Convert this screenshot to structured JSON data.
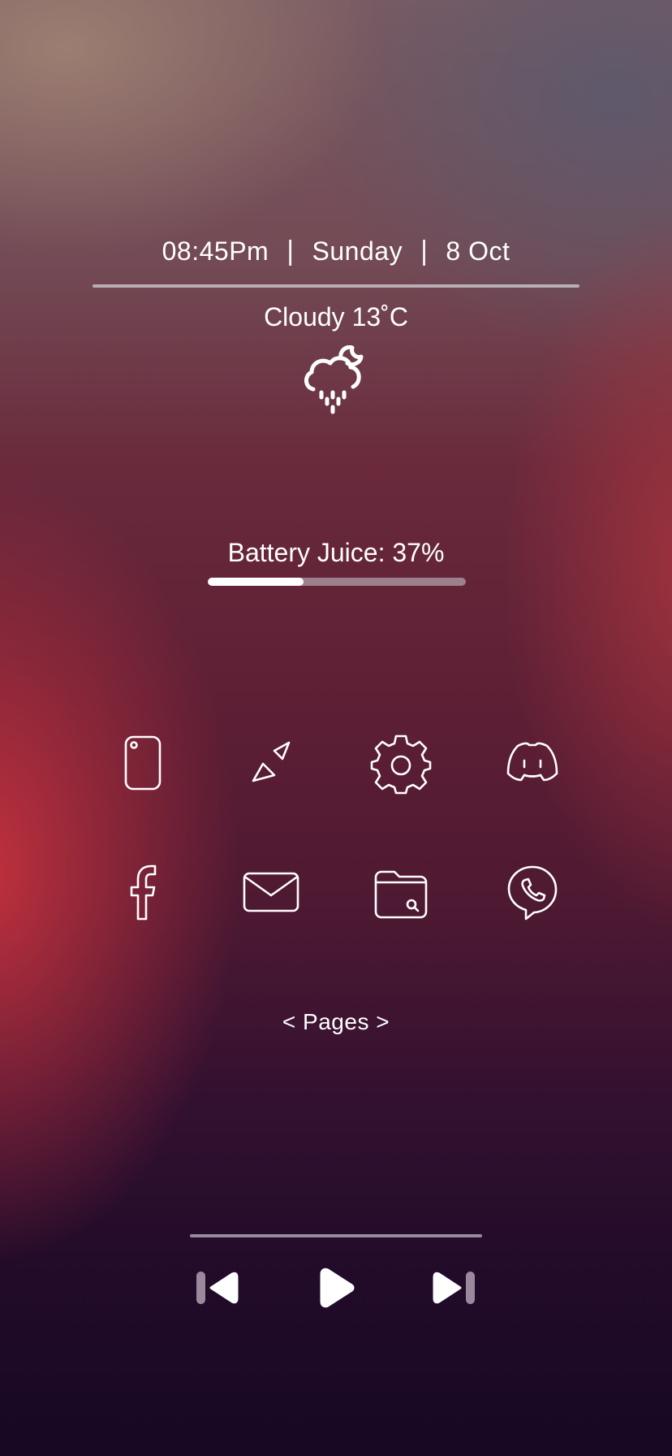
{
  "header": {
    "time": "08:45Pm",
    "day": "Sunday",
    "date": "8 Oct",
    "separator": "|"
  },
  "weather": {
    "text": "Cloudy 13˚C",
    "icon": "cloud-rain-moon-icon"
  },
  "battery": {
    "label": "Battery Juice: 37%",
    "level": 0.37
  },
  "apps": [
    {
      "name": "phone-device-icon"
    },
    {
      "name": "compass-icon"
    },
    {
      "name": "settings-gear-icon"
    },
    {
      "name": "discord-icon"
    },
    {
      "name": "facebook-icon"
    },
    {
      "name": "mail-icon"
    },
    {
      "name": "files-folder-icon"
    },
    {
      "name": "viber-phone-icon"
    }
  ],
  "pager": {
    "label": "< Pages >"
  },
  "media": {
    "controls": [
      "previous-track-icon",
      "play-icon",
      "next-track-icon"
    ]
  },
  "colors": {
    "text": "#ffffff",
    "progress_fill": "#ffffff",
    "progress_track": "#afa0aa"
  }
}
